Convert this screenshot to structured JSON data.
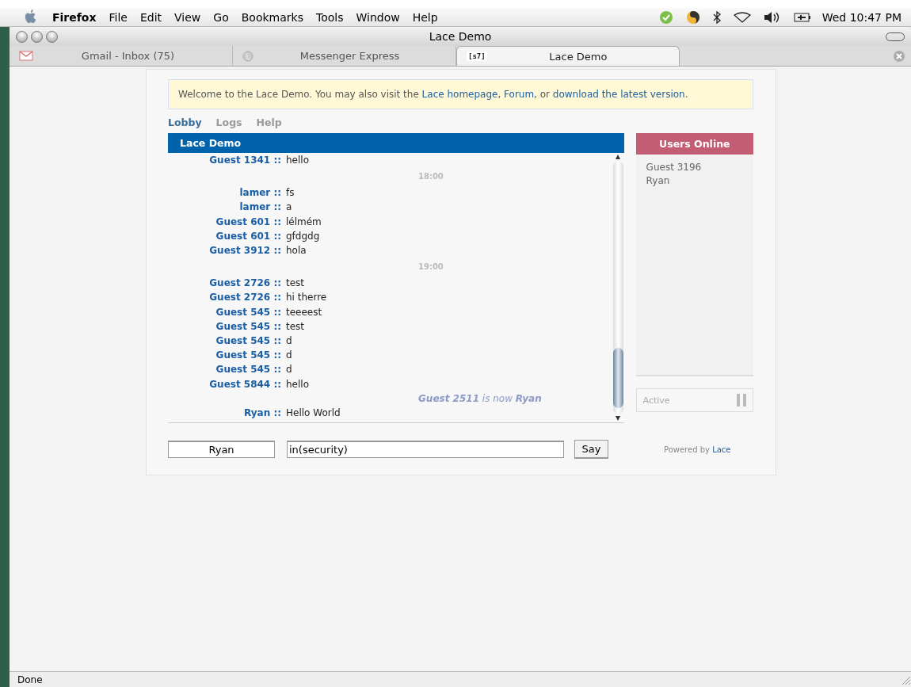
{
  "menu_bar": {
    "app": "Firefox",
    "items": [
      "File",
      "Edit",
      "View",
      "Go",
      "Bookmarks",
      "Tools",
      "Window",
      "Help"
    ],
    "clock": "Wed 10:47 PM"
  },
  "window": {
    "title": "Lace Demo"
  },
  "browser_tabs": [
    {
      "label": "Gmail - Inbox (75)",
      "kind": "mail",
      "selected": false
    },
    {
      "label": "Messenger Express",
      "kind": "globe",
      "selected": false
    },
    {
      "label": "Lace Demo",
      "kind": "badge",
      "badge": "[s7]",
      "selected": true
    }
  ],
  "welcome": {
    "text": "Welcome to the Lace Demo. You may also visit the ",
    "links": [
      "Lace homepage",
      ", ",
      "Forum",
      ", or ",
      "download the latest version",
      "."
    ]
  },
  "nav_tabs": [
    {
      "label": "Lobby",
      "selected": true
    },
    {
      "label": "Logs",
      "selected": false
    },
    {
      "label": "Help",
      "selected": false
    }
  ],
  "chat": {
    "title": "Lace Demo",
    "messages": [
      {
        "kind": "message",
        "name": "Guest 1341",
        "text": "hello"
      },
      {
        "kind": "time",
        "text": "18:00"
      },
      {
        "kind": "message",
        "name": "lamer",
        "text": "fs"
      },
      {
        "kind": "message",
        "name": "lamer",
        "text": "a"
      },
      {
        "kind": "message",
        "name": "Guest 601",
        "text": "lélmém"
      },
      {
        "kind": "message",
        "name": "Guest 601",
        "text": "gfdgdg"
      },
      {
        "kind": "message",
        "name": "Guest 3912",
        "text": "hola"
      },
      {
        "kind": "time",
        "text": "19:00"
      },
      {
        "kind": "message",
        "name": "Guest 2726",
        "text": "test"
      },
      {
        "kind": "message",
        "name": "Guest 2726",
        "text": "hi therre"
      },
      {
        "kind": "message",
        "name": "Guest 545",
        "text": "teeeest"
      },
      {
        "kind": "message",
        "name": "Guest 545",
        "text": "test"
      },
      {
        "kind": "message",
        "name": "Guest 545",
        "text": "d"
      },
      {
        "kind": "message",
        "name": "Guest 545",
        "text": "d"
      },
      {
        "kind": "message",
        "name": "Guest 545",
        "text": "d"
      },
      {
        "kind": "message",
        "name": "Guest 5844",
        "text": "hello"
      },
      {
        "kind": "notice",
        "text": "**Guest 2511** is now **Ryan**"
      },
      {
        "kind": "message",
        "name": "Ryan",
        "text": "Hello World"
      }
    ],
    "separator": "::"
  },
  "users_online": {
    "title": "Users Online",
    "users": [
      "Guest 3196",
      "Ryan"
    ],
    "status": "Active"
  },
  "input": {
    "name": "Ryan",
    "message": "in(security)",
    "button": "Say"
  },
  "powered_by": {
    "text": "Powered by",
    "link": "Lace"
  },
  "status_bar": "Done"
}
